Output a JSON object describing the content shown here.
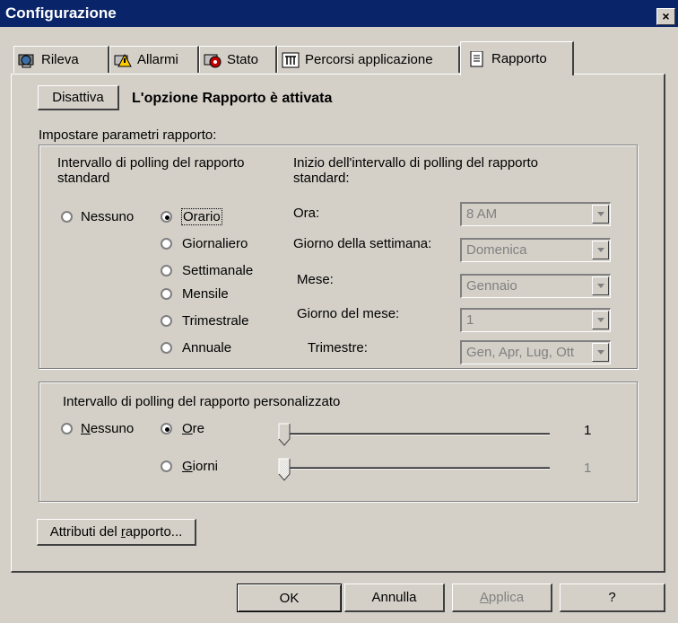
{
  "window": {
    "title": "Configurazione",
    "close_glyph": "×"
  },
  "tabs": [
    {
      "label": "Rileva",
      "icon": "detect-icon"
    },
    {
      "label": "Allarmi",
      "icon": "alarm-icon"
    },
    {
      "label": "Stato",
      "icon": "status-icon"
    },
    {
      "label": "Percorsi applicazione",
      "icon": "path-icon"
    },
    {
      "label": "Rapporto",
      "icon": "report-icon",
      "active": true
    }
  ],
  "report": {
    "disable_button": "Disattiva",
    "status_text": "L'opzione Rapporto è attivata",
    "params_label": "Impostare parametri rapporto:"
  },
  "standard": {
    "interval_title_1": "Intervallo di polling del rapporto",
    "interval_title_2": "standard",
    "options": {
      "none": "Nessuno",
      "hourly": "Orario",
      "daily": "Giornaliero",
      "weekly": "Settimanale",
      "monthly": "Mensile",
      "quarterly": "Trimestrale",
      "yearly": "Annuale"
    },
    "selected": "hourly",
    "start_title_1": "Inizio dell'intervallo di polling del rapporto",
    "start_title_2": "standard:",
    "fields": {
      "hour_label": "Ora:",
      "hour_value": "8 AM",
      "weekday_label": "Giorno della settimana:",
      "weekday_value": "Domenica",
      "month_label": "Mese:",
      "month_value": "Gennaio",
      "monthday_label": "Giorno del mese:",
      "monthday_value": "1",
      "quarter_label": "Trimestre:",
      "quarter_value": "Gen, Apr, Lug, Ott"
    }
  },
  "custom": {
    "title": "Intervallo di polling del rapporto personalizzato",
    "none_label": "Nessuno",
    "hours_label": "Ore",
    "days_label": "Giorni",
    "selected": "hours",
    "hours_value": "1",
    "days_value": "1"
  },
  "attributes_button": "Attributi del rapporto...",
  "footer": {
    "ok": "OK",
    "cancel": "Annulla",
    "apply": "Applica",
    "help": "?"
  }
}
